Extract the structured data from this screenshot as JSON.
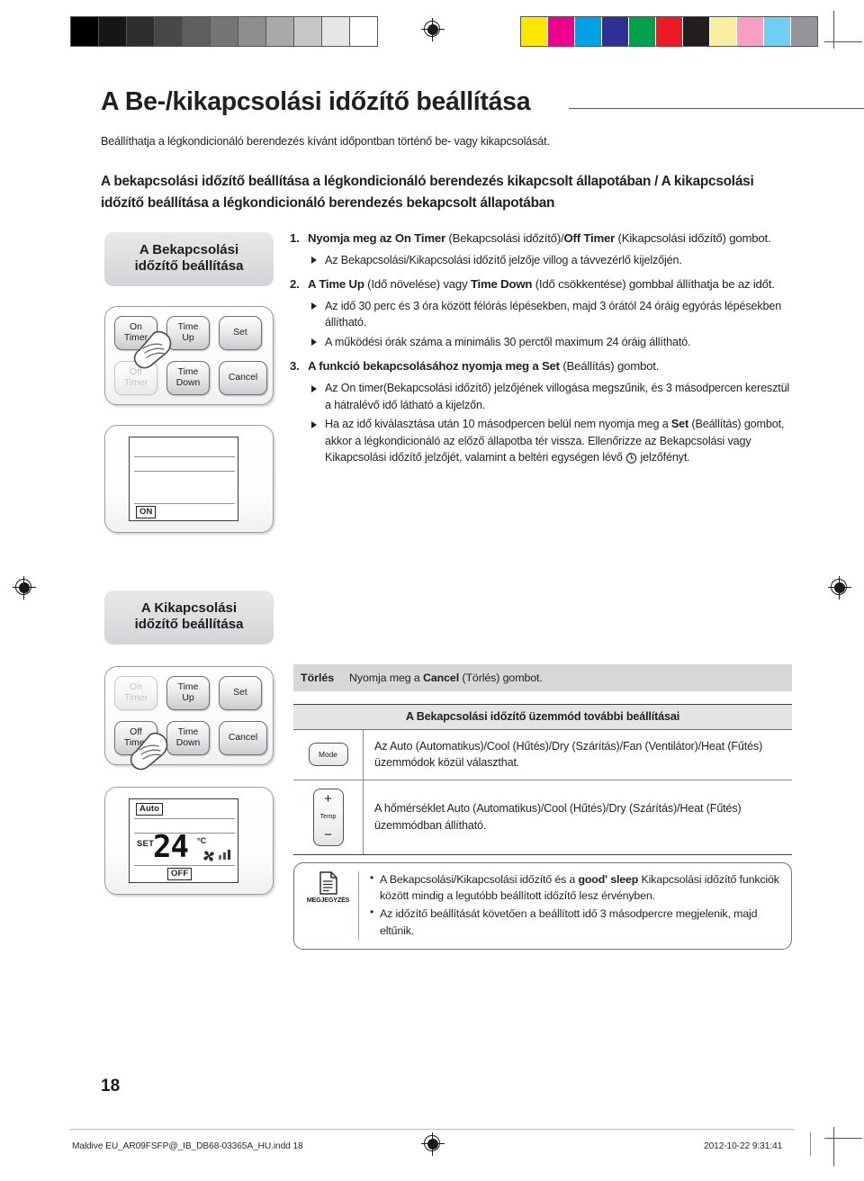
{
  "document": {
    "title": "A Be-/kikapcsolási időzítő beállítása",
    "intro": "Beállíthatja a légkondicionáló berendezés kívánt időpontban történő be- vagy kikapcsolását.",
    "lead": "A bekapcsolási időzítő beállítása a légkondicionáló berendezés kikapcsolt állapotában / A kikapcsolási időzítő beállítása a légkondicionáló berendezés bekapcsolt állapotában",
    "page_number": "18"
  },
  "calibration": {
    "grayscale": [
      "#000000",
      "#161616",
      "#2e2e2e",
      "#484848",
      "#5e5e5e",
      "#757575",
      "#8f8f8f",
      "#a9a9a9",
      "#c6c6c6",
      "#e6e6e6",
      "#ffffff"
    ],
    "colors": [
      "#ffe800",
      "#ec008c",
      "#00a2e3",
      "#2e3192",
      "#00a14b",
      "#ed1c24",
      "#231f20",
      "#f9eda0",
      "#f89fc4",
      "#72cdf4",
      "#939598"
    ]
  },
  "panel_on": {
    "heading": "A Bekapcsolási\nidőzítő beállítása",
    "heading_line1": "A Bekapcsolási",
    "heading_line2": "időzítő beállítása",
    "buttons": [
      {
        "label_line1": "On",
        "label_line2": "Timer",
        "state": "active"
      },
      {
        "label_line1": "Time",
        "label_line2": "Up",
        "state": "active"
      },
      {
        "label_line1": "Set",
        "label_line2": "",
        "state": "active"
      },
      {
        "label_line1": "Off",
        "label_line2": "Timer",
        "state": "dimmed"
      },
      {
        "label_line1": "Time",
        "label_line2": "Down",
        "state": "active"
      },
      {
        "label_line1": "Cancel",
        "label_line2": "",
        "state": "active"
      }
    ],
    "lcd": {
      "status_tag": "ON"
    }
  },
  "panel_off": {
    "heading_line1": "A Kikapcsolási",
    "heading_line2": "időzítő beállítása",
    "buttons": [
      {
        "label_line1": "On",
        "label_line2": "Timer",
        "state": "dimmed"
      },
      {
        "label_line1": "Time",
        "label_line2": "Up",
        "state": "active"
      },
      {
        "label_line1": "Set",
        "label_line2": "",
        "state": "active"
      },
      {
        "label_line1": "Off",
        "label_line2": "Timer",
        "state": "active"
      },
      {
        "label_line1": "Time",
        "label_line2": "Down",
        "state": "active"
      },
      {
        "label_line1": "Cancel",
        "label_line2": "",
        "state": "active"
      }
    ],
    "lcd": {
      "mode_tag": "Auto",
      "set_label": "SET",
      "temperature": "24",
      "degree_unit": "°C",
      "status_tag": "OFF",
      "fan_bars": 3
    }
  },
  "steps": [
    {
      "number": "1.",
      "head_html": "Nyomja meg az <b>On Timer</b> <span class=\"plain\">(Bekapcsolási időzítő)/</span><b>Off Timer</b> <span class=\"plain\">(Kikapcsolási időzítő) gombot.</span>",
      "bullets": [
        "Az Bekapcsolási/Kikapcsolási időzítő jelzője villog a távvezérlő kijelzőjén."
      ]
    },
    {
      "number": "2.",
      "head_html": "A <b>Time Up</b> <span class=\"plain\">(Idő növelése) vagy</span> <b>Time Down</b> <span class=\"plain\">(Idő csökkentése) gombbal állíthatja be az időt.</span>",
      "bullets": [
        "Az idő 30 perc és 3 óra között félórás lépésekben, majd 3 órától 24 óráig egyórás lépésekben állítható.",
        "A működési órák száma a minimális 30 perctől maximum 24 óráig állítható."
      ]
    },
    {
      "number": "3.",
      "head_html": "A funkció bekapcsolásához nyomja meg a <b>Set</b> <span class=\"plain\">(Beállítás) gombot.</span>",
      "bullets": [
        "Az On timer(Bekapcsolási időzítő) jelzőjének villogása megszűnik, és 3 másodpercen keresztül a hátralévő idő látható a kijelzőn.",
        "Ha az idő kiválasztása után 10 másodpercen belül nem nyomja meg a <b>Set</b> (Beállítás) gombot, akkor a légkondicionáló az előző állapotba tér vissza. Ellenőrizze az Bekapcsolási vagy Kikapcsolási időzítő jelzőjét, valamint a beltéri egységen lévő [clock] jelzőfényt."
      ]
    }
  ],
  "cancel_row": {
    "label": "Törlés",
    "text_html": "Nyomja meg a <b>Cancel</b> (Törlés) gombot."
  },
  "options_table": {
    "header": "A Bekapcsolási időzítő üzemmód további beállításai",
    "rows": [
      {
        "icon_label": "Mode",
        "icon_type": "mode-button",
        "text": "Az Auto (Automatikus)/Cool (Hűtés)/Dry (Szárítás)/Fan (Ventilátor)/Heat (Fűtés) üzemmódok közül választhat."
      },
      {
        "icon_label": "Temp",
        "icon_type": "temp-button",
        "icon_plus": "+",
        "icon_minus": "−",
        "text": "A hőmérséklet Auto (Automatikus)/Cool (Hűtés)/Dry (Szárítás)/Heat (Fűtés) üzemmódban állítható."
      }
    ]
  },
  "note_box": {
    "icon_label": "MEGJEGYZÉS",
    "items_html": [
      "A Bekapcsolási/Kikapcsolási időzítő és a <b>good' sleep</b> Kikapcsolási időzítő funkciók között mindig a legutóbb beállított időzítő lesz érvényben.",
      "Az időzítő beállítását követően a beállított idő 3 másodpercre megjelenik, majd eltűnik."
    ]
  },
  "footer": {
    "left": "Maldive EU_AR09FSFP@_IB_DB68-03365A_HU.indd   18",
    "right": "2012-10-22   9:31:41"
  }
}
